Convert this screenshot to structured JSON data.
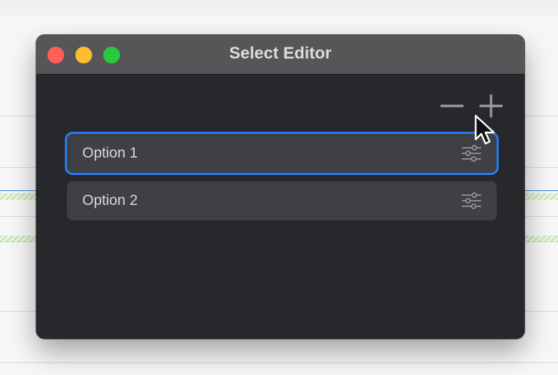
{
  "window": {
    "title": "Select Editor"
  },
  "toolbar": {
    "remove_icon": "minus-icon",
    "add_icon": "plus-icon"
  },
  "options": [
    {
      "label": "Option 1",
      "selected": true,
      "icon": "sliders-icon"
    },
    {
      "label": "Option 2",
      "selected": false,
      "icon": "sliders-icon"
    }
  ],
  "colors": {
    "selection": "#1f7ef5",
    "window_bg": "#27282b",
    "titlebar_bg": "#565659",
    "close": "#fe5f57",
    "minimize": "#febc2e",
    "maximize": "#28c840"
  }
}
